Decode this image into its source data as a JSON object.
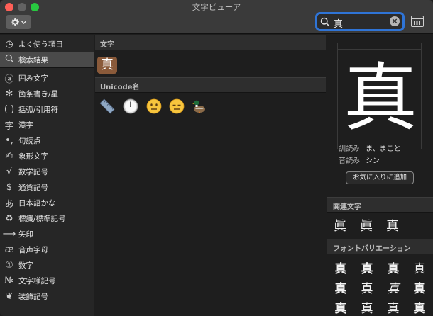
{
  "window": {
    "title": "文字ビューア"
  },
  "toolbar": {
    "search": {
      "value": "真"
    }
  },
  "sidebar": {
    "items": [
      {
        "icon": "clock-icon",
        "glyph": "◷",
        "label": "よく使う項目"
      },
      {
        "icon": "magnifier-icon",
        "glyph": "",
        "label": "検索結果"
      },
      {
        "icon": "letter-a-circle-icon",
        "glyph": "ⓐ",
        "label": "囲み文字"
      },
      {
        "icon": "asterisk-icon",
        "glyph": "✻",
        "label": "箇条書き/星"
      },
      {
        "icon": "parentheses-icon",
        "glyph": "( )",
        "label": "括弧/引用符"
      },
      {
        "icon": "kanji-icon",
        "glyph": "字",
        "label": "漢字"
      },
      {
        "icon": "punctuation-icon",
        "glyph": "•,",
        "label": "句読点"
      },
      {
        "icon": "pictograph-icon",
        "glyph": "✍",
        "label": "象形文字"
      },
      {
        "icon": "square-root-icon",
        "glyph": "√",
        "label": "数学記号"
      },
      {
        "icon": "dollar-icon",
        "glyph": "$",
        "label": "通貨記号"
      },
      {
        "icon": "hiragana-a-icon",
        "glyph": "あ",
        "label": "日本語かな"
      },
      {
        "icon": "recycle-icon",
        "glyph": "♻",
        "label": "標識/標準記号"
      },
      {
        "icon": "arrow-right-icon",
        "glyph": "⟶",
        "label": "矢印"
      },
      {
        "icon": "ae-ligature-icon",
        "glyph": "æ",
        "label": "音声字母"
      },
      {
        "icon": "circled-one-icon",
        "glyph": "①",
        "label": "数字"
      },
      {
        "icon": "numero-icon",
        "glyph": "№",
        "label": "文字様記号"
      },
      {
        "icon": "heart-ornament-icon",
        "glyph": "❦",
        "label": "装飾記号"
      }
    ],
    "selected_index": 1
  },
  "main": {
    "sections": [
      {
        "title": "文字",
        "chars": [
          "真"
        ]
      },
      {
        "title": "Unicode名",
        "emojis": [
          "straight-ruler-icon",
          "clock-face-icon",
          "neutral-face-icon",
          "expressionless-face-icon",
          "duck-icon"
        ]
      }
    ]
  },
  "detail": {
    "glyph": "真",
    "readings": [
      {
        "key": "訓読み",
        "value": "ま、まこと"
      },
      {
        "key": "音読み",
        "value": "シン"
      }
    ],
    "favorite_button": "お気に入りに追加",
    "related_header": "関連文字",
    "related": [
      "眞",
      "眞",
      "真"
    ],
    "variations_header": "フォントバリエーション",
    "variations": [
      "真",
      "真",
      "真",
      "真",
      "真",
      "真",
      "真",
      "真",
      "真",
      "真",
      "真",
      "真"
    ]
  }
}
